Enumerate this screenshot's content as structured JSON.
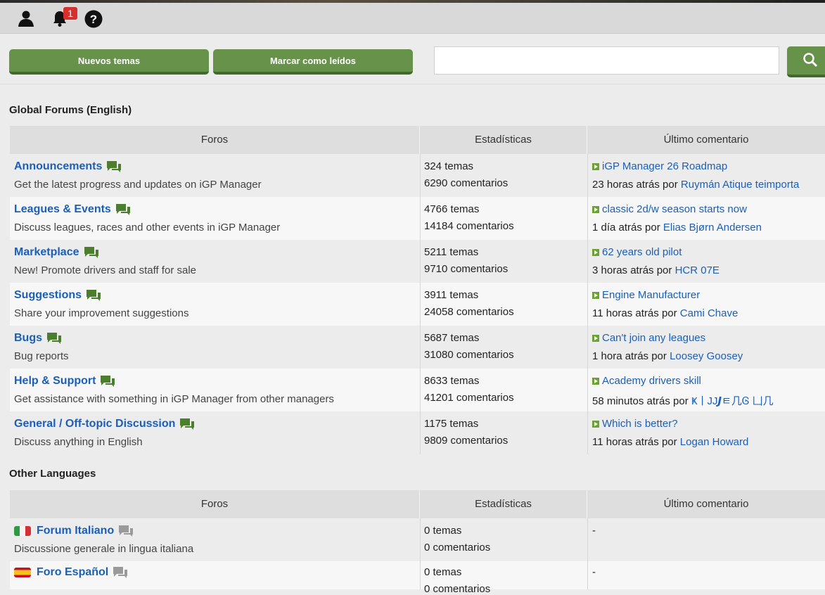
{
  "topbar": {
    "icons": [
      "user-icon",
      "bell-icon",
      "help-icon"
    ],
    "notification_count": "1"
  },
  "actions": {
    "new_topics": "Nuevos temas",
    "mark_read": "Marcar como leídos",
    "search_placeholder": "",
    "search_icon": "search-icon"
  },
  "colors": {
    "accent_green": "#67924a",
    "link_blue": "#1b5fb8",
    "badge_red": "#d6302e"
  },
  "global": {
    "title": "Global Forums (English)",
    "headers": {
      "forums": "Foros",
      "stats": "Estadísticas",
      "last": "Último comentario"
    },
    "rows": [
      {
        "title": "Announcements",
        "desc": "Get the latest progress and updates on iGP Manager",
        "topics": "324 temas",
        "comments": "6290 comentarios",
        "last_title": "iGP Manager 26 Roadmap",
        "last_time": "23 horas atrás por ",
        "last_user": "Ruymán Atique teimporta"
      },
      {
        "title": "Leagues & Events",
        "desc": "Discuss leagues, races and other events in iGP Manager",
        "topics": "4766 temas",
        "comments": "14184 comentarios",
        "last_title": "classic 2d/w season starts now",
        "last_time": "1 día atrás por ",
        "last_user": "Elias Bjørn Andersen"
      },
      {
        "title": "Marketplace",
        "desc": "New! Promote drivers and staff for sale",
        "topics": "5211 temas",
        "comments": "9710 comentarios",
        "last_title": "62 years old pilot",
        "last_time": "3 horas atrás por ",
        "last_user": "HCR 07E"
      },
      {
        "title": "Suggestions",
        "desc": "Share your improvement suggestions",
        "topics": "3911 temas",
        "comments": "24058 comentarios",
        "last_title": "Engine Manufacturer",
        "last_time": "11 horas atrás por ",
        "last_user": "Cami Chave"
      },
      {
        "title": "Bugs",
        "desc": "Bug reports",
        "topics": "5687 temas",
        "comments": "31080 comentarios",
        "last_title": "Can't join any leagues",
        "last_time": "1 hora atrás por ",
        "last_user": "Loosey Goosey"
      },
      {
        "title": "Help & Support",
        "desc": "Get assistance with something in iGP Manager from other managers",
        "topics": "8633 temas",
        "comments": "41201 comentarios",
        "last_title": "Academy drivers skill",
        "last_time": "58 minutos atrás por ",
        "last_user": "ҜㅣJJ𝙅ㅌ几Ꮆ 凵几"
      },
      {
        "title": "General / Off-topic Discussion",
        "desc": "Discuss anything in English",
        "topics": "1175 temas",
        "comments": "9809 comentarios",
        "last_title": "Which is better?",
        "last_time": "11 horas atrás por ",
        "last_user": "Logan Howard"
      }
    ]
  },
  "other": {
    "title": "Other Languages",
    "headers": {
      "forums": "Foros",
      "stats": "Estadísticas",
      "last": "Último comentario"
    },
    "rows": [
      {
        "title": "Forum Italiano",
        "desc": "Discussione generale in lingua italiana",
        "topics": "0 temas",
        "comments": "0 comentarios",
        "last": "-",
        "flag": "italy-flag-icon"
      },
      {
        "title": "Foro Español",
        "desc": "",
        "topics": "0 temas",
        "comments": "0 comentarios",
        "last": "-",
        "flag": "spain-flag-icon"
      }
    ]
  }
}
